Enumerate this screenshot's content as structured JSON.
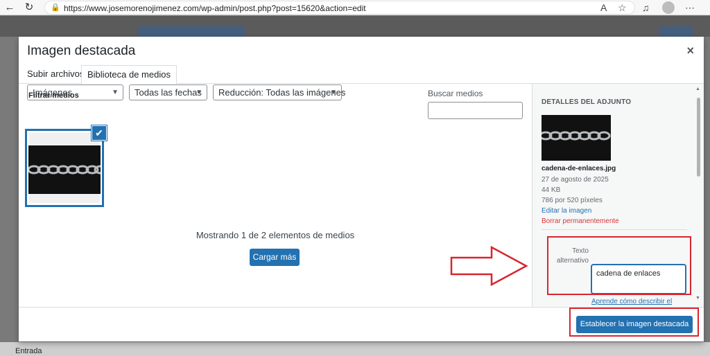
{
  "browser": {
    "url": "https://www.josemorenojimenez.com/wp-admin/post.php?post=15620&action=edit"
  },
  "background": {
    "bottom_label": "Entrada"
  },
  "modal": {
    "title": "Imagen destacada",
    "close": "×",
    "tabs": [
      {
        "label": "Subir archivos",
        "active": false
      },
      {
        "label": "Biblioteca de medios",
        "active": true
      }
    ],
    "filters": {
      "label": "Filtrar medios",
      "type_value": "Imágenes",
      "date_value": "Todas las fechas",
      "reduction_value": "Reducción: Todas las imágenes"
    },
    "search": {
      "label": "Buscar medios",
      "placeholder": ""
    },
    "showing_text": "Mostrando 1 de 2 elementos de medios",
    "load_more": "Cargar más",
    "set_button": "Establecer la imagen destacada"
  },
  "sidebar": {
    "heading": "Detalles del adjunto",
    "filename": "cadena-de-enlaces.jpg",
    "date": "27 de agosto de 2025",
    "size": "44 KB",
    "dimensions": "786 por 520 píxeles",
    "edit_link": "Editar la imagen",
    "delete_link": "Borrar permanentemente",
    "alt_label_line1": "Texto",
    "alt_label_line2": "alternativo",
    "alt_value": "cadena de enlaces",
    "learn_link": "Aprende cómo describir el"
  },
  "colors": {
    "primary": "#2271b1",
    "danger": "#d63638",
    "annotation": "#d8252f"
  }
}
